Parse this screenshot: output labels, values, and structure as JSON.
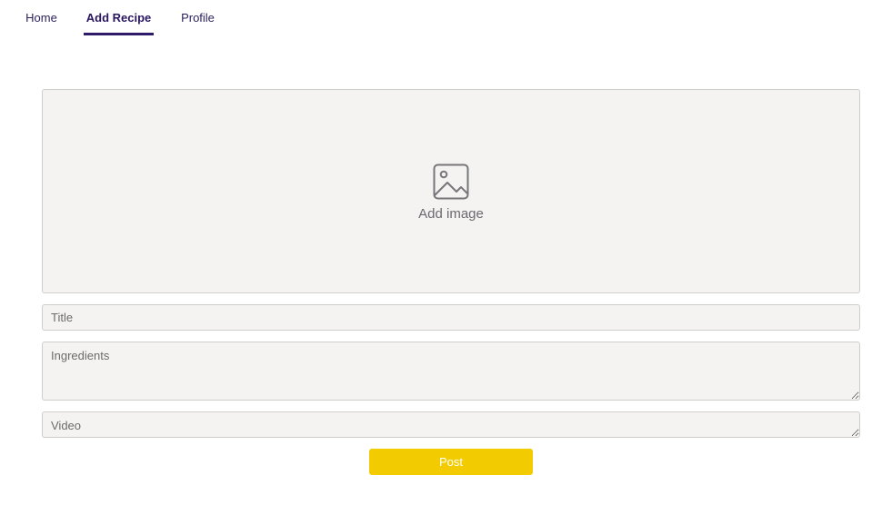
{
  "nav": {
    "tabs": [
      {
        "label": "Home"
      },
      {
        "label": "Add Recipe",
        "active": true
      },
      {
        "label": "Profile"
      }
    ]
  },
  "image_upload": {
    "icon": "image-icon",
    "label": "Add image"
  },
  "form": {
    "title_placeholder": "Title",
    "ingredients_placeholder": "Ingredients",
    "video_placeholder": "Video",
    "post_label": "Post"
  },
  "colors": {
    "accent": "#2e1a6b",
    "button": "#f2cb00",
    "field_bg": "#f4f3f1"
  }
}
